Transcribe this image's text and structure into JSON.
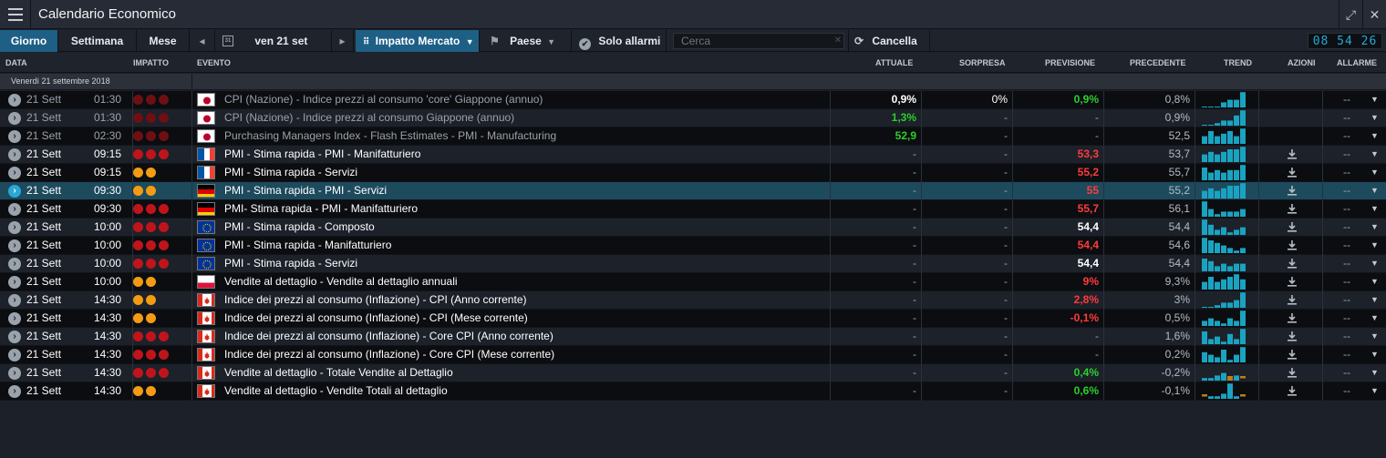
{
  "window": {
    "title": "Calendario Economico",
    "expand_icon": "expand-icon",
    "close_icon": "close-icon"
  },
  "toolbar": {
    "tab_day": "Giorno",
    "tab_week": "Settimana",
    "tab_month": "Mese",
    "prev_icon": "◂",
    "calendar_icon": "calendar-icon",
    "date": "ven 21 set",
    "next_icon": "▸",
    "impact": "Impatto Mercato",
    "country": "Paese",
    "alarms": "Solo allarmi",
    "search_placeholder": "Cerca",
    "clear": "Cancella",
    "clock": "08 54 26"
  },
  "columns": {
    "date": "DATA",
    "impact": "IMPATTO",
    "event": "EVENTO",
    "actual": "ATTUALE",
    "surprise": "SORPRESA",
    "forecast": "PREVISIONE",
    "previous": "PRECEDENTE",
    "trend": "TREND",
    "actions": "AZIONI",
    "alarm": "ALLARME"
  },
  "group_label": "Venerdì 21 settembre 2018",
  "colors": {
    "accent": "#1e5f86",
    "red": "#ff3b3b",
    "green": "#2bd02b",
    "orange": "#f39c12",
    "impact_red": "#c0141b",
    "trend_bar": "#1aa3c1"
  },
  "rows": [
    {
      "day": "21 Sett",
      "time": "01:30",
      "impact": 3,
      "impact_color": "dim-red",
      "country": "JP",
      "event": "CPI (Nazione) - Indice prezzi al consumo 'core' Giappone (annuo)",
      "actual": "0,9%",
      "actual_color": "white",
      "surprise": "0%",
      "forecast": "0,9%",
      "forecast_color": "green",
      "previous": "0,8%",
      "dim": true,
      "trend": [
        0,
        0,
        0,
        2,
        3,
        3,
        6
      ],
      "download": false,
      "alarm": "--"
    },
    {
      "day": "21 Sett",
      "time": "01:30",
      "impact": 3,
      "impact_color": "dim-red",
      "country": "JP",
      "event": "CPI (Nazione) - Indice prezzi al consumo Giappone (annuo)",
      "actual": "1,3%",
      "actual_color": "green",
      "surprise": "-",
      "forecast": "-",
      "forecast_color": "gray",
      "previous": "0,9%",
      "dim": true,
      "trend": [
        0,
        0,
        1,
        2,
        2,
        4,
        6
      ],
      "download": false,
      "alarm": "--"
    },
    {
      "day": "21 Sett",
      "time": "02:30",
      "impact": 3,
      "impact_color": "dim-red",
      "country": "JP",
      "event": "Purchasing Managers Index - Flash Estimates - PMI - Manufacturing",
      "actual": "52,9",
      "actual_color": "green",
      "surprise": "-",
      "forecast": "-",
      "forecast_color": "gray",
      "previous": "52,5",
      "dim": true,
      "trend": [
        3,
        5,
        3,
        4,
        5,
        3,
        6
      ],
      "download": false,
      "alarm": "--"
    },
    {
      "day": "21 Sett",
      "time": "09:15",
      "impact": 3,
      "impact_color": "red",
      "country": "FR",
      "event": "PMI - Stima rapida - PMI - Manifatturiero",
      "actual": "-",
      "actual_color": "gray",
      "surprise": "-",
      "forecast": "53,3",
      "forecast_color": "red",
      "previous": "53,7",
      "dim": false,
      "trend": [
        3,
        4,
        3,
        4,
        5,
        5,
        6
      ],
      "download": true,
      "alarm": "--"
    },
    {
      "day": "21 Sett",
      "time": "09:15",
      "impact": 2,
      "impact_color": "orange",
      "country": "FR",
      "event": "PMI - Stima rapida - Servizi",
      "actual": "-",
      "actual_color": "gray",
      "surprise": "-",
      "forecast": "55,2",
      "forecast_color": "red",
      "previous": "55,7",
      "dim": false,
      "trend": [
        5,
        3,
        4,
        3,
        4,
        4,
        6
      ],
      "download": true,
      "alarm": "--"
    },
    {
      "day": "21 Sett",
      "time": "09:30",
      "impact": 2,
      "impact_color": "orange",
      "country": "DE",
      "event": "PMI - Stima rapida - PMI - Servizi",
      "actual": "-",
      "actual_color": "gray",
      "surprise": "-",
      "forecast": "55",
      "forecast_color": "red",
      "previous": "55,2",
      "dim": false,
      "selected": true,
      "trend": [
        3,
        4,
        3,
        4,
        5,
        5,
        6
      ],
      "download": true,
      "alarm": "--"
    },
    {
      "day": "21 Sett",
      "time": "09:30",
      "impact": 3,
      "impact_color": "red",
      "country": "DE",
      "event": "PMI- Stima rapida - PMI - Manifatturiero",
      "actual": "-",
      "actual_color": "gray",
      "surprise": "-",
      "forecast": "55,7",
      "forecast_color": "red",
      "previous": "56,1",
      "dim": false,
      "trend": [
        6,
        3,
        1,
        2,
        2,
        2,
        3
      ],
      "download": true,
      "alarm": "--"
    },
    {
      "day": "21 Sett",
      "time": "10:00",
      "impact": 3,
      "impact_color": "red",
      "country": "EU",
      "event": "PMI - Stima rapida - Composto",
      "actual": "-",
      "actual_color": "gray",
      "surprise": "-",
      "forecast": "54,4",
      "forecast_color": "white",
      "previous": "54,4",
      "dim": false,
      "trend": [
        6,
        4,
        2,
        3,
        1,
        2,
        3
      ],
      "download": true,
      "alarm": "--"
    },
    {
      "day": "21 Sett",
      "time": "10:00",
      "impact": 3,
      "impact_color": "red",
      "country": "EU",
      "event": "PMI - Stima rapida - Manifatturiero",
      "actual": "-",
      "actual_color": "gray",
      "surprise": "-",
      "forecast": "54,4",
      "forecast_color": "red",
      "previous": "54,6",
      "dim": false,
      "trend": [
        6,
        5,
        4,
        3,
        2,
        1,
        2
      ],
      "download": true,
      "alarm": "--"
    },
    {
      "day": "21 Sett",
      "time": "10:00",
      "impact": 3,
      "impact_color": "red",
      "country": "EU",
      "event": "PMI - Stima rapida - Servizi",
      "actual": "-",
      "actual_color": "gray",
      "surprise": "-",
      "forecast": "54,4",
      "forecast_color": "white",
      "previous": "54,4",
      "dim": false,
      "trend": [
        5,
        4,
        2,
        3,
        2,
        3,
        3
      ],
      "download": true,
      "alarm": "--"
    },
    {
      "day": "21 Sett",
      "time": "10:00",
      "impact": 2,
      "impact_color": "orange",
      "country": "PL",
      "event": "Vendite al dettaglio - Vendite al dettaglio annuali",
      "actual": "-",
      "actual_color": "gray",
      "surprise": "-",
      "forecast": "9%",
      "forecast_color": "red",
      "previous": "9,3%",
      "dim": false,
      "trend": [
        3,
        5,
        3,
        4,
        5,
        6,
        4
      ],
      "download": true,
      "alarm": "--"
    },
    {
      "day": "21 Sett",
      "time": "14:30",
      "impact": 2,
      "impact_color": "orange",
      "country": "CA",
      "event": "Indice dei prezzi al consumo (Inflazione) - CPI (Anno corrente)",
      "actual": "-",
      "actual_color": "gray",
      "surprise": "-",
      "forecast": "2,8%",
      "forecast_color": "red",
      "previous": "3%",
      "dim": false,
      "trend": [
        0,
        0,
        1,
        2,
        2,
        3,
        6
      ],
      "download": true,
      "alarm": "--"
    },
    {
      "day": "21 Sett",
      "time": "14:30",
      "impact": 2,
      "impact_color": "orange",
      "country": "CA",
      "event": "Indice dei prezzi al consumo (Inflazione) - CPI (Mese corrente)",
      "actual": "-",
      "actual_color": "gray",
      "surprise": "-",
      "forecast": "-0,1%",
      "forecast_color": "red",
      "previous": "0,5%",
      "dim": false,
      "trend": [
        2,
        3,
        2,
        1,
        3,
        2,
        6
      ],
      "download": true,
      "alarm": "--"
    },
    {
      "day": "21 Sett",
      "time": "14:30",
      "impact": 3,
      "impact_color": "red",
      "country": "CA",
      "event": "Indice dei prezzi al consumo (Inflazione) - Core CPI (Anno corrente)",
      "actual": "-",
      "actual_color": "gray",
      "surprise": "-",
      "forecast": "-",
      "forecast_color": "gray",
      "previous": "1,6%",
      "dim": false,
      "trend": [
        5,
        2,
        3,
        1,
        4,
        2,
        6
      ],
      "download": true,
      "alarm": "--"
    },
    {
      "day": "21 Sett",
      "time": "14:30",
      "impact": 3,
      "impact_color": "red",
      "country": "CA",
      "event": "Indice dei prezzi al consumo (Inflazione) - Core CPI (Mese corrente)",
      "actual": "-",
      "actual_color": "gray",
      "surprise": "-",
      "forecast": "-",
      "forecast_color": "gray",
      "previous": "0,2%",
      "dim": false,
      "trend": [
        4,
        3,
        2,
        5,
        1,
        3,
        6
      ],
      "download": true,
      "alarm": "--"
    },
    {
      "day": "21 Sett",
      "time": "14:30",
      "impact": 3,
      "impact_color": "red",
      "country": "CA",
      "event": "Vendite al dettaglio - Totale Vendite al Dettaglio",
      "actual": "-",
      "actual_color": "gray",
      "surprise": "-",
      "forecast": "0,4%",
      "forecast_color": "green",
      "previous": "-0,2%",
      "dim": false,
      "trend": [
        1,
        1,
        2,
        3,
        -2,
        2,
        -1
      ],
      "download": true,
      "alarm": "--"
    },
    {
      "day": "21 Sett",
      "time": "14:30",
      "impact": 2,
      "impact_color": "orange",
      "country": "CA",
      "event": "Vendite al dettaglio - Vendite Totali al dettaglio",
      "actual": "-",
      "actual_color": "gray",
      "surprise": "-",
      "forecast": "0,6%",
      "forecast_color": "green",
      "previous": "-0,1%",
      "dim": false,
      "trend": [
        -1,
        1,
        1,
        2,
        6,
        1,
        -1
      ],
      "download": true,
      "alarm": "--"
    }
  ]
}
